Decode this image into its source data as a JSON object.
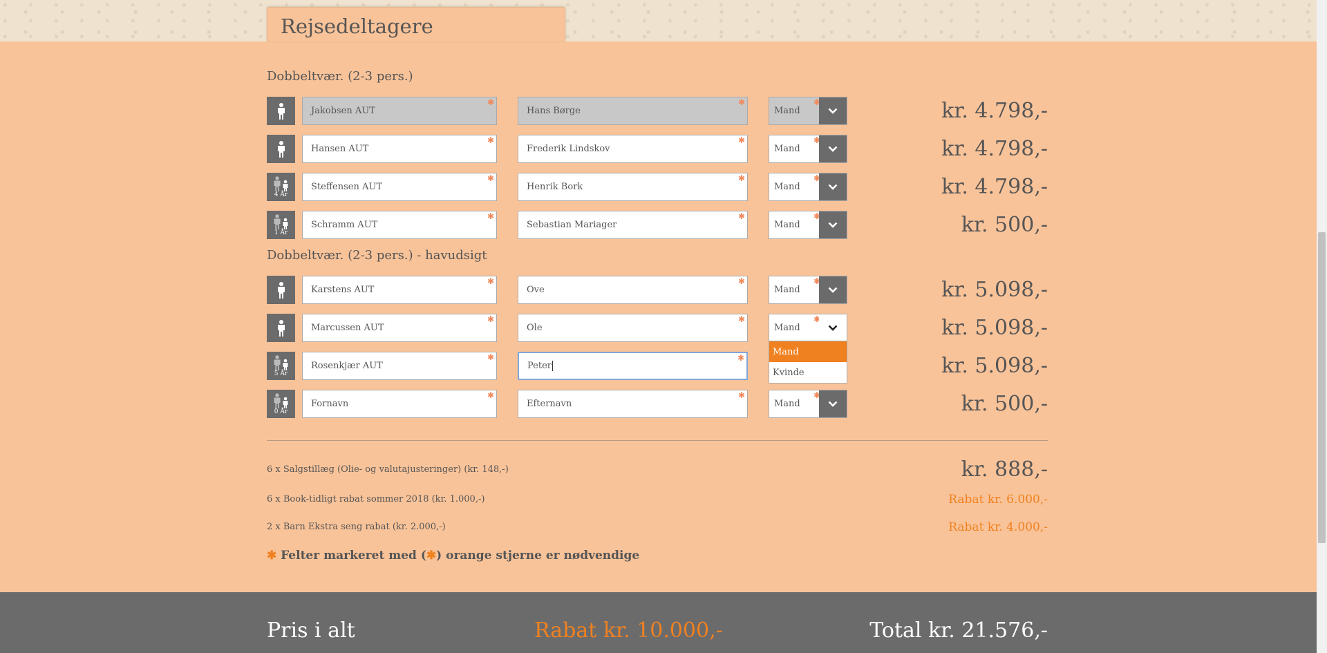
{
  "section_tab": {
    "title": "Rejsedeltagere"
  },
  "groups": [
    {
      "title": "Dobbeltvær. (2-3 pers.)",
      "participants": [
        {
          "type": "adult",
          "age_label": "",
          "last_name": "Jakobsen AUT",
          "first_name": "Hans Børge",
          "gender": "Mand",
          "price": "kr. 4.798,-",
          "locked": true
        },
        {
          "type": "adult",
          "age_label": "",
          "last_name": "Hansen AUT",
          "first_name": "Frederik Lindskov",
          "gender": "Mand",
          "price": "kr. 4.798,-"
        },
        {
          "type": "child",
          "age_label": "4 År",
          "last_name": "Steffensen AUT",
          "first_name": "Henrik Bork",
          "gender": "Mand",
          "price": "kr. 4.798,-"
        },
        {
          "type": "child",
          "age_label": "1 År",
          "last_name": "Schramm AUT",
          "first_name": "Sebastian Mariager",
          "gender": "Mand",
          "price": "kr. 500,-"
        }
      ]
    },
    {
      "title": "Dobbeltvær. (2-3 pers.) - havudsigt",
      "participants": [
        {
          "type": "adult",
          "age_label": "",
          "last_name": "Karstens AUT",
          "first_name": "Ove",
          "gender": "Mand",
          "price": "kr. 5.098,-"
        },
        {
          "type": "adult",
          "age_label": "",
          "last_name": "Marcussen AUT",
          "first_name": "Ole",
          "gender": "Mand",
          "price": "kr. 5.098,-",
          "dropdown_open": true
        },
        {
          "type": "child",
          "age_label": "5 År",
          "last_name": "Rosenkjær AUT",
          "first_name": "Peter",
          "gender": "",
          "price": "kr. 5.098,-",
          "focused": true
        },
        {
          "type": "child",
          "age_label": "0 År",
          "last_name": "",
          "first_name": "",
          "last_placeholder": "Fornavn",
          "first_placeholder": "Efternavn",
          "gender": "Mand",
          "price": "kr. 500,-"
        }
      ]
    }
  ],
  "gender_options": [
    "Mand",
    "Kvinde"
  ],
  "surcharges": [
    {
      "label": "6 x Salgstillæg (Olie- og valutajusteringer) (kr. 148,-)",
      "value": "kr. 888,-"
    }
  ],
  "discounts": [
    {
      "label": "6 x Book-tidligt rabat sommer 2018 (kr. 1.000,-)",
      "value": "Rabat kr. 6.000,-"
    },
    {
      "label": "2 x Barn Ekstra seng rabat (kr. 2.000,-)",
      "value": "Rabat kr. 4.000,-"
    }
  ],
  "required_note": {
    "star": "✱",
    "before": " Felter markeret med (",
    "after": ") orange stjerne er nødvendige"
  },
  "footer": {
    "label": "Pris i alt",
    "discount": "Rabat kr. 10.000,-",
    "total": "Total kr. 21.576,-"
  },
  "colors": {
    "accent": "#f08120",
    "background": "#f9c399",
    "dark": "#6b6b6b"
  },
  "icons": {
    "adult": "person-icon",
    "child": "adult-child-icon",
    "dropdown": "chevron-down-icon"
  }
}
